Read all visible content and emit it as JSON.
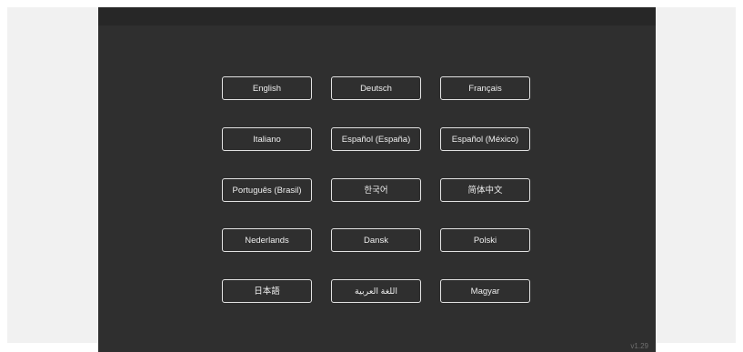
{
  "languages": {
    "english": "English",
    "deutsch": "Deutsch",
    "francais": "Français",
    "italiano": "Italiano",
    "espanol_espana": "Español (España)",
    "espanol_mexico": "Español (México)",
    "portugues_brasil": "Português (Brasil)",
    "korean": "한국어",
    "chinese_simplified": "简体中文",
    "nederlands": "Nederlands",
    "dansk": "Dansk",
    "polski": "Polski",
    "japanese": "日本語",
    "arabic": "اللغة العربية",
    "magyar": "Magyar"
  },
  "version": "v1.29",
  "colors": {
    "background": "#2f2f2f",
    "button_border": "#e2e2e2",
    "button_text": "#ededed"
  }
}
